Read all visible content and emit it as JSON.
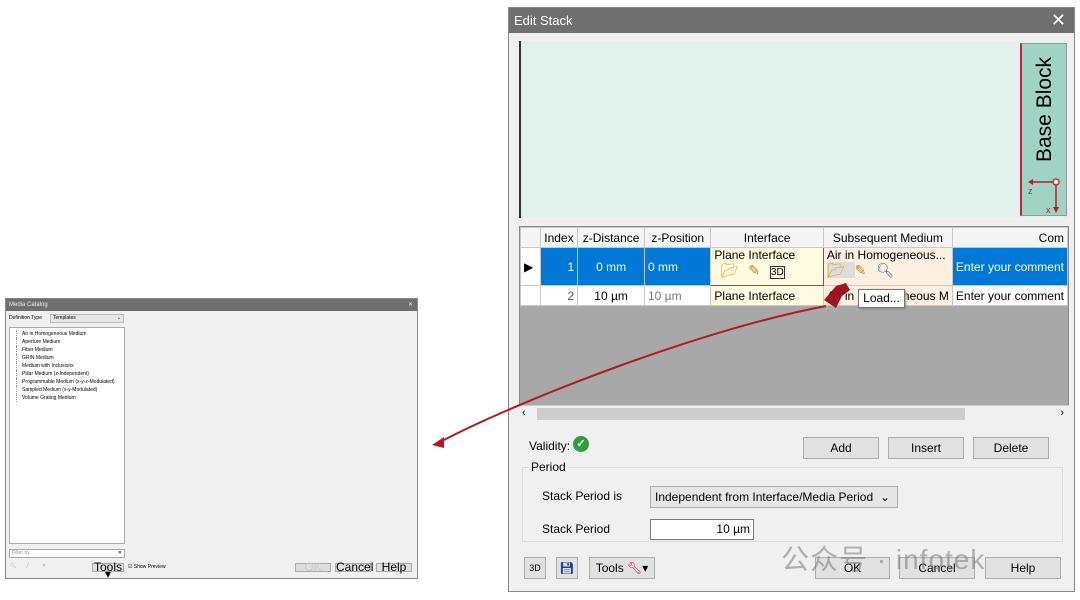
{
  "media_catalog": {
    "title": "Media Catalog",
    "close": "✕",
    "definition_type_label": "Definition Type",
    "definition_type_value": "Templates",
    "tree_items": [
      "Air in Homogeneous Medium",
      "Aperture Medium",
      "Fiber Medium",
      "GRIN Medium",
      "Medium with Inclusions",
      "Pillar Medium (z-Independent)",
      "Programmable Medium (x-y-z-Modulated)",
      "Sampled Medium (x-y-Modulated)",
      "Volume Grating Medium"
    ],
    "filter_placeholder": "Filter by...",
    "tools_label": "Tools",
    "show_preview_label": "Show Preview",
    "show_preview_checked": true,
    "ok_label": "OK",
    "cancel_label": "Cancel",
    "help_label": "Help"
  },
  "edit_stack": {
    "title": "Edit Stack",
    "close": "✕",
    "preview": {
      "base_block_label": "Base Block",
      "axis_z": "z",
      "axis_x": "x"
    },
    "table": {
      "columns": [
        "Index",
        "z-Distance",
        "z-Position",
        "Interface",
        "Subsequent Medium",
        "Com"
      ],
      "rows": [
        {
          "index": "1",
          "z_distance": "0 mm",
          "z_position": "0 mm",
          "interface": "Plane Interface",
          "medium": "Air in Homogeneous...",
          "comment": "Enter your comment",
          "selected": true
        },
        {
          "index": "2",
          "z_distance": "10 µm",
          "z_position": "10 µm",
          "interface": "Plane Interface",
          "medium": "Air in Homogeneous M",
          "comment": "Enter your comment",
          "selected": false
        }
      ]
    },
    "tooltip": "Load...",
    "validity_label": "Validity:",
    "add_label": "Add",
    "insert_label": "Insert",
    "delete_label": "Delete",
    "period_group": "Period",
    "stack_period_is_label": "Stack Period is",
    "stack_period_is_value": "Independent from Interface/Media Period",
    "stack_period_label": "Stack Period",
    "stack_period_value": "10 µm",
    "tools_label": "Tools",
    "ok_label": "OK",
    "cancel_label": "Cancel",
    "help_label": "Help"
  },
  "watermark": "公众号 · infotek",
  "colors": {
    "selection": "#0078d7",
    "arrow": "#b01a24",
    "base_block": "#9fd4c4",
    "preview_bg": "#e3f1ec",
    "validity_ok": "#2e9e3e"
  }
}
